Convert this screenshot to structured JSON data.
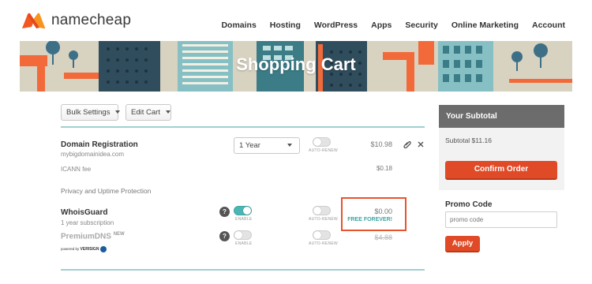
{
  "brand": {
    "name": "namecheap",
    "accent": "#f25722"
  },
  "nav": [
    "Domains",
    "Hosting",
    "WordPress",
    "Apps",
    "Security",
    "Online Marketing",
    "Account"
  ],
  "banner": {
    "title": "Shopping Cart"
  },
  "toolbar": {
    "bulk_settings": "Bulk Settings",
    "edit_cart": "Edit Cart"
  },
  "cart": {
    "domain": {
      "title": "Domain Registration",
      "name": "mybigdomainidea.com",
      "period": "1 Year",
      "autorenew_label": "AUTO-RENEW",
      "price": "$10.98",
      "icann_label": "ICANN fee",
      "icann_price": "$0.18"
    },
    "section_title": "Privacy and Uptime Protection",
    "whoisguard": {
      "title": "WhoisGuard",
      "subtitle": "1 year subscription",
      "enable_label": "ENABLE",
      "autorenew_label": "AUTO-RENEW",
      "price": "$0.00",
      "promo": "FREE FOREVER!"
    },
    "premiumdns": {
      "title": "PremiumDNS",
      "badge": "NEW",
      "powered_by": "powered by",
      "powered_brand": "VERISIGN",
      "enable_label": "ENABLE",
      "autorenew_label": "AUTO-RENEW",
      "price": "$4.88"
    }
  },
  "summary": {
    "heading": "Your Subtotal",
    "subtotal": "Subtotal $11.16",
    "confirm": "Confirm Order",
    "promo_label": "Promo Code",
    "promo_placeholder": "promo code",
    "apply": "Apply"
  },
  "colors": {
    "teal": "#4bb6b4",
    "orange_button": "#e04a27",
    "highlight": "#e8532c"
  }
}
